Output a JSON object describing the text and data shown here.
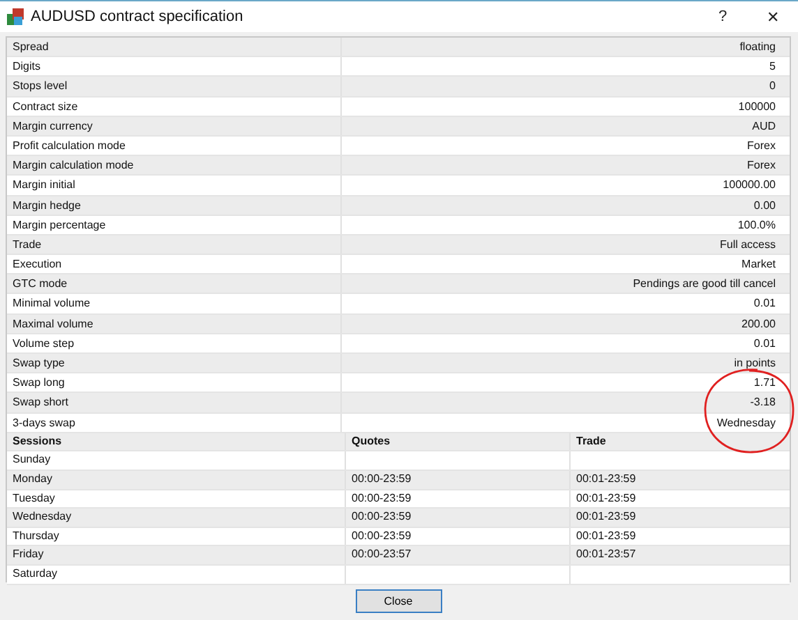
{
  "window": {
    "title": "AUDUSD contract specification",
    "help": "?",
    "close": "✕"
  },
  "spec": [
    {
      "label": "Spread",
      "value": "floating"
    },
    {
      "label": "Digits",
      "value": "5"
    },
    {
      "label": "Stops level",
      "value": "0"
    },
    {
      "label": "Contract size",
      "value": "100000"
    },
    {
      "label": "Margin currency",
      "value": "AUD"
    },
    {
      "label": "Profit calculation mode",
      "value": "Forex"
    },
    {
      "label": "Margin calculation mode",
      "value": "Forex"
    },
    {
      "label": "Margin initial",
      "value": "100000.00"
    },
    {
      "label": "Margin hedge",
      "value": "0.00"
    },
    {
      "label": "Margin percentage",
      "value": "100.0%"
    },
    {
      "label": "Trade",
      "value": "Full access"
    },
    {
      "label": "Execution",
      "value": "Market"
    },
    {
      "label": "GTC mode",
      "value": "Pendings are good till cancel"
    },
    {
      "label": "Minimal volume",
      "value": "0.01"
    },
    {
      "label": "Maximal volume",
      "value": "200.00"
    },
    {
      "label": "Volume step",
      "value": "0.01"
    },
    {
      "label": "Swap type",
      "value": "in points"
    },
    {
      "label": "Swap long",
      "value": "1.71"
    },
    {
      "label": "Swap short",
      "value": "-3.18"
    },
    {
      "label": "3-days swap",
      "value": "Wednesday"
    }
  ],
  "sessions": {
    "columns": [
      "Sessions",
      "Quotes",
      "Trade"
    ],
    "rows": [
      {
        "day": "Sunday"
      },
      {
        "day": "Monday",
        "quotes": "00:00-23:59",
        "trade": "00:01-23:59"
      },
      {
        "day": "Tuesday",
        "quotes": "00:00-23:59",
        "trade": "00:01-23:59"
      },
      {
        "day": "Wednesday",
        "quotes": "00:00-23:59",
        "trade": "00:01-23:59"
      },
      {
        "day": "Thursday",
        "quotes": "00:00-23:59",
        "trade": "00:01-23:59"
      },
      {
        "day": "Friday",
        "quotes": "00:00-23:57",
        "trade": "00:01-23:57"
      },
      {
        "day": "Saturday"
      }
    ]
  },
  "buttons": [
    "Close"
  ]
}
